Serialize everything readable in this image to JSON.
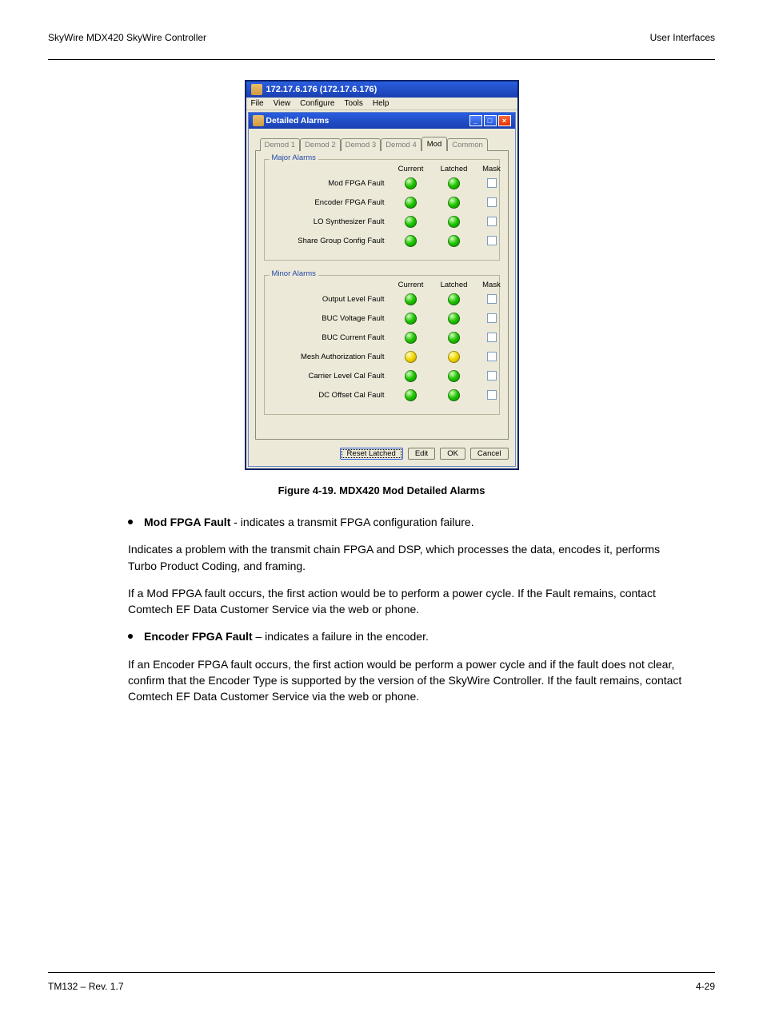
{
  "header": {
    "left": "SkyWire MDX420 SkyWire Controller",
    "right": "User Interfaces"
  },
  "footer": {
    "left": "TM132 – Rev. 1.7",
    "right": "4-29"
  },
  "dialog": {
    "outer_title": "172.17.6.176 (172.17.6.176)",
    "menu": [
      "File",
      "View",
      "Configure",
      "Tools",
      "Help"
    ],
    "inner_title": "Detailed Alarms",
    "tabs": [
      "Demod 1",
      "Demod 2",
      "Demod 3",
      "Demod 4",
      "Mod",
      "Common"
    ],
    "active_tab": "Mod",
    "cols": [
      "",
      "Current",
      "Latched",
      "Mask"
    ],
    "major_legend": "Major Alarms",
    "minor_legend": "Minor Alarms",
    "major": [
      {
        "label": "Mod FPGA Fault",
        "cur": "green",
        "lat": "green"
      },
      {
        "label": "Encoder FPGA Fault",
        "cur": "green",
        "lat": "green"
      },
      {
        "label": "LO Synthesizer Fault",
        "cur": "green",
        "lat": "green"
      },
      {
        "label": "Share Group Config Fault",
        "cur": "green",
        "lat": "green"
      }
    ],
    "minor": [
      {
        "label": "Output Level Fault",
        "cur": "green",
        "lat": "green"
      },
      {
        "label": "BUC Voltage Fault",
        "cur": "green",
        "lat": "green"
      },
      {
        "label": "BUC Current Fault",
        "cur": "green",
        "lat": "green"
      },
      {
        "label": "Mesh Authorization Fault",
        "cur": "yellow",
        "lat": "yellow"
      },
      {
        "label": "Carrier Level Cal Fault",
        "cur": "green",
        "lat": "green"
      },
      {
        "label": "DC Offset Cal Fault",
        "cur": "green",
        "lat": "green"
      }
    ],
    "buttons": {
      "reset": "Reset Latched",
      "edit": "Edit",
      "ok": "OK",
      "cancel": "Cancel"
    }
  },
  "caption": "Figure 4-19. MDX420 Mod Detailed Alarms",
  "text": {
    "b1_lead": "Mod FPGA Fault",
    "b1_rest": " - indicates a transmit FPGA configuration failure.",
    "p1": "Indicates a problem with the transmit chain FPGA and DSP, which processes the data, encodes it, performs Turbo Product Coding, and framing.",
    "p2": "If a Mod FPGA fault occurs, the first action would be to perform a power cycle. If the Fault remains, contact Comtech EF Data Customer Service via the web or phone.",
    "b2_lead": "Encoder FPGA Fault",
    "b2_rest": " – indicates a failure in the encoder.",
    "p3": "If an Encoder FPGA fault occurs, the first action would be perform a power cycle and if the fault does not clear, confirm that the Encoder Type is supported by the version of the SkyWire Controller. If the fault remains, contact Comtech EF Data Customer Service via the web or phone."
  }
}
